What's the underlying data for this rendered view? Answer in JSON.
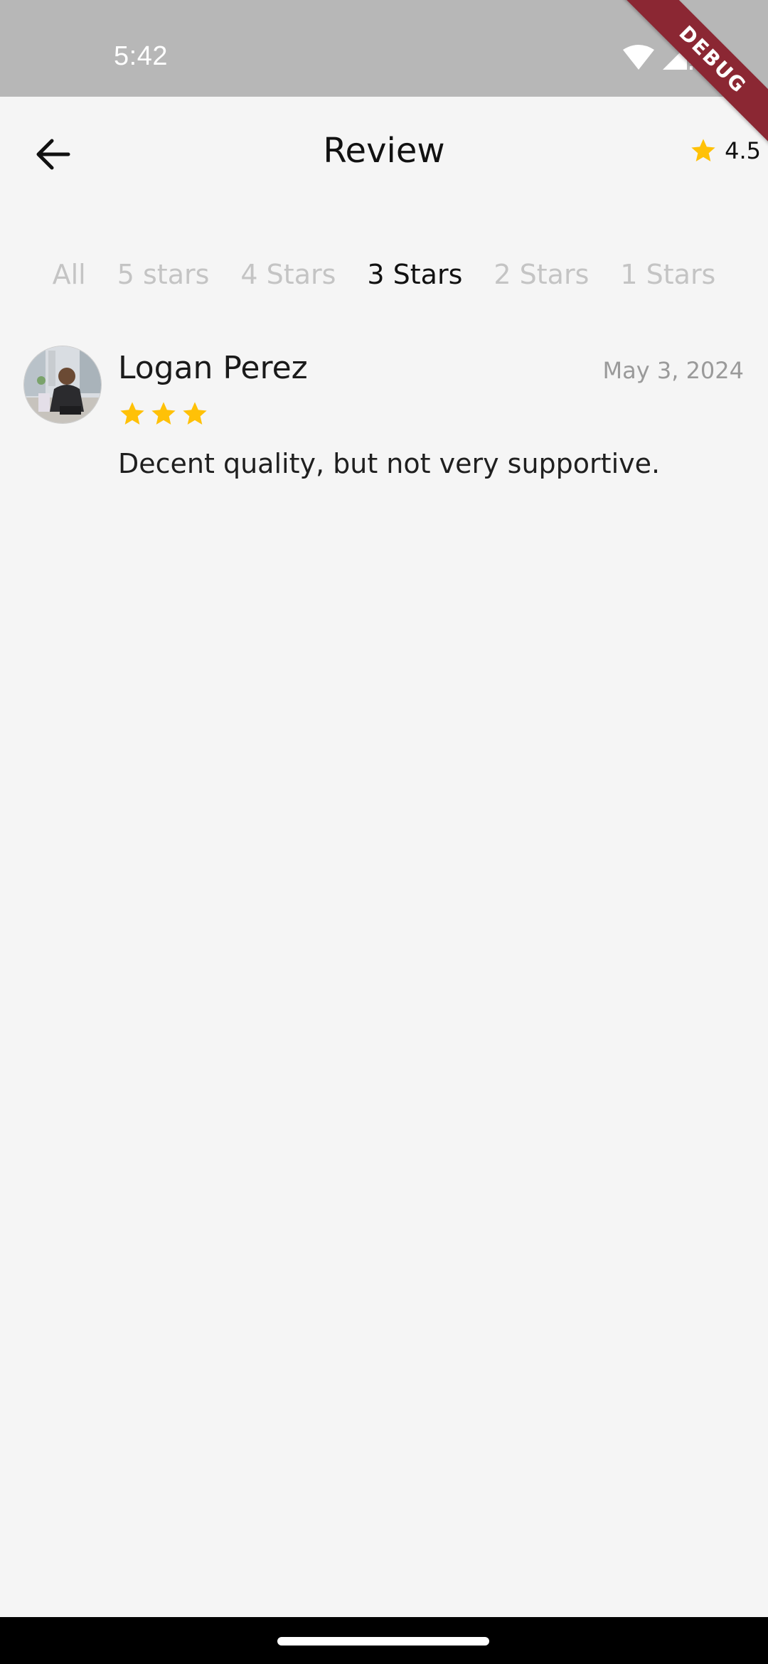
{
  "status_bar": {
    "time": "5:42",
    "icons": [
      "wifi-icon",
      "signal-icon",
      "battery-icon"
    ]
  },
  "debug_banner": {
    "label": "DEBUG",
    "color": "#8b2733"
  },
  "header": {
    "back_icon": "arrow-left-icon",
    "title": "Review",
    "rating": {
      "icon": "star-icon",
      "value": "4.5"
    }
  },
  "tabs": [
    {
      "label": "All",
      "active": false
    },
    {
      "label": "5 stars",
      "active": false
    },
    {
      "label": "4 Stars",
      "active": false
    },
    {
      "label": "3 Stars",
      "active": true
    },
    {
      "label": "2 Stars",
      "active": false
    },
    {
      "label": "1 Stars",
      "active": false
    }
  ],
  "reviews": [
    {
      "name": "Logan Perez",
      "date": "May 3, 2024",
      "stars": 3,
      "text": "Decent quality, but not very supportive."
    }
  ],
  "colors": {
    "background": "#f5f5f5",
    "status_bar": "#b7b7b7",
    "star": "#ffc107",
    "tab_inactive": "#c4c4c4",
    "tab_active": "#111111"
  }
}
